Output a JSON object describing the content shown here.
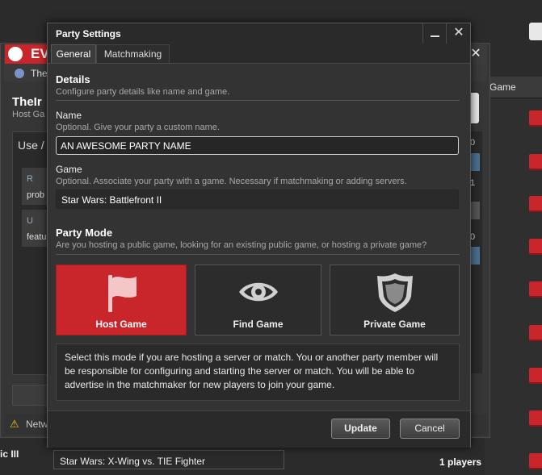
{
  "background": {
    "app_logo_text": "EV",
    "subbar_text": "The",
    "party_title": "TheIr",
    "party_sub": "Host Ga",
    "use_label": "Use /",
    "card1_link": "R",
    "card1_text": "prob",
    "card2_link": "U",
    "card2_text": "featu",
    "right_col_values": [
      "0",
      "1",
      "0"
    ],
    "game_column_header": "Game",
    "network_text": "Netw",
    "left_truncated": "ic III",
    "list_item_game": "Star Wars: X-Wing vs. TIE Fighter",
    "list_item_players": "1 players"
  },
  "dialog": {
    "title": "Party Settings",
    "close_glyph": "✕",
    "tabs": [
      {
        "label": "General"
      },
      {
        "label": "Matchmaking"
      }
    ],
    "details": {
      "title": "Details",
      "subtitle": "Configure party details like name and game."
    },
    "name_field": {
      "label": "Name",
      "hint": "Optional. Give your party a custom name.",
      "value": "AN AWESOME PARTY NAME"
    },
    "game_field": {
      "label": "Game",
      "hint": "Optional. Associate your party with a game. Necessary if matchmaking or adding servers.",
      "value": "Star Wars: Battlefront II"
    },
    "party_mode": {
      "title": "Party Mode",
      "subtitle": "Are you hosting a public game, looking for an existing public game, or hosting a private game?",
      "options": [
        {
          "label": "Host Game",
          "icon": "flag-icon",
          "selected": true
        },
        {
          "label": "Find Game",
          "icon": "eye-icon",
          "selected": false
        },
        {
          "label": "Private Game",
          "icon": "shield-icon",
          "selected": false
        }
      ],
      "description": "Select this mode if you are hosting a server or match. You or another party member will be responsible for configuring and starting the server or match. You will be able to advertise in the matchmaker for new players to join your game."
    },
    "buttons": {
      "update": "Update",
      "cancel": "Cancel"
    }
  },
  "colors": {
    "accent_red": "#c9262c",
    "dialog_bg": "#333333",
    "titlebar_bg": "#2a2a2a"
  }
}
